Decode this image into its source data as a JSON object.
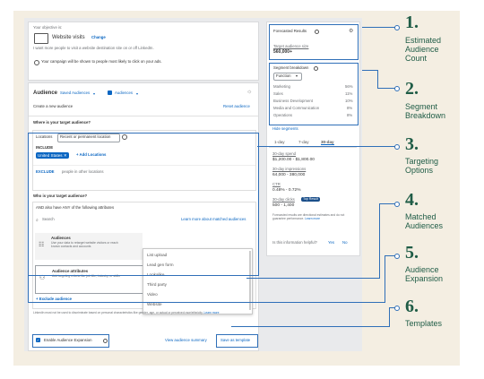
{
  "objective": {
    "label": "Your objective is:",
    "value": "Website visits",
    "change": "Change",
    "desc": "I want more people to visit a website destination site on or off LinkedIn.",
    "info": "Your campaign will be shown to people most likely to click on your ads."
  },
  "audience": {
    "title": "Audience",
    "saved": "Saved Audiences",
    "linkedin": "Audiences",
    "create": "Create a new audience",
    "reset": "Reset audience"
  },
  "location": {
    "question": "Where is your target audience?",
    "label": "Locations",
    "select": "Recent or permanent location",
    "include": "INCLUDE",
    "tag": "United States",
    "add": "+ Add Locations",
    "exclude": "EXCLUDE",
    "exclude_desc": "people in other locations"
  },
  "who": {
    "question": "Who is your target audience?",
    "and_text": "AND also have ANY of the following attributes",
    "search": "Search",
    "learn": "Learn more about matched audiences",
    "audiences_title": "Audiences",
    "audiences_desc": "Use your data to retarget website visitors or reach known contacts and accounts",
    "attr_title": "Audience attributes",
    "attr_desc": "Add targeting criteria like job title, industry, or skills",
    "exclude": "+ Exclude audience",
    "footer": "LinkedIn must not be used to discriminate based on personal characteristics like gender, age, or actual or perceived race/ethnicity.",
    "footer_link": "Learn more"
  },
  "dropdown": {
    "items": [
      "List upload",
      "Lead gen form",
      "Lookalike",
      "Third party",
      "Video",
      "Website"
    ]
  },
  "bottom": {
    "expansion": "Enable Audience Expansion",
    "view": "View audience summary",
    "save": "Save as template"
  },
  "forecast": {
    "title": "Forecasted Results",
    "size_label": "Target audience size",
    "size_value": "560,000+",
    "segment_title": "Segment breakdown",
    "segment_select": "Function",
    "rows": [
      {
        "name": "Marketing",
        "pct": "56%"
      },
      {
        "name": "Sales",
        "pct": "11%"
      },
      {
        "name": "Business Development",
        "pct": "10%"
      },
      {
        "name": "Media and Communication",
        "pct": "8%"
      },
      {
        "name": "Operations",
        "pct": "8%"
      }
    ],
    "hide": "Hide segments",
    "tabs": [
      "1-day",
      "7-day",
      "30-day"
    ],
    "spend_label": "30-day spend",
    "spend_value": "$1,200.00 - $1,800.00",
    "impr_label": "30-day impressions",
    "impr_value": "64,000 - 380,000",
    "ctr_label": "CTR",
    "ctr_value": "0.48% - 0.72%",
    "clicks_label": "30-day clicks",
    "clicks_badge": "Top Result",
    "clicks_value": "500 - 1,400",
    "note": "Forecasted results are directional estimates and do not guarantee performance.",
    "note_link": "Learn more",
    "helpful": "Is this information helpful?",
    "yes": "Yes",
    "no": "No"
  },
  "annotations": [
    {
      "num": "1.",
      "label": "Estimated Audience Count"
    },
    {
      "num": "2.",
      "label": "Segment Breakdown"
    },
    {
      "num": "3.",
      "label": "Targeting Options"
    },
    {
      "num": "4.",
      "label": "Matched Audiences"
    },
    {
      "num": "5.",
      "label": "Audience Expansion"
    },
    {
      "num": "6.",
      "label": "Templates"
    }
  ],
  "colors": {
    "accent": "#0a66c2",
    "annotation": "#1f5c46",
    "connector": "#2f6fb8",
    "background": "#f4eee2"
  }
}
